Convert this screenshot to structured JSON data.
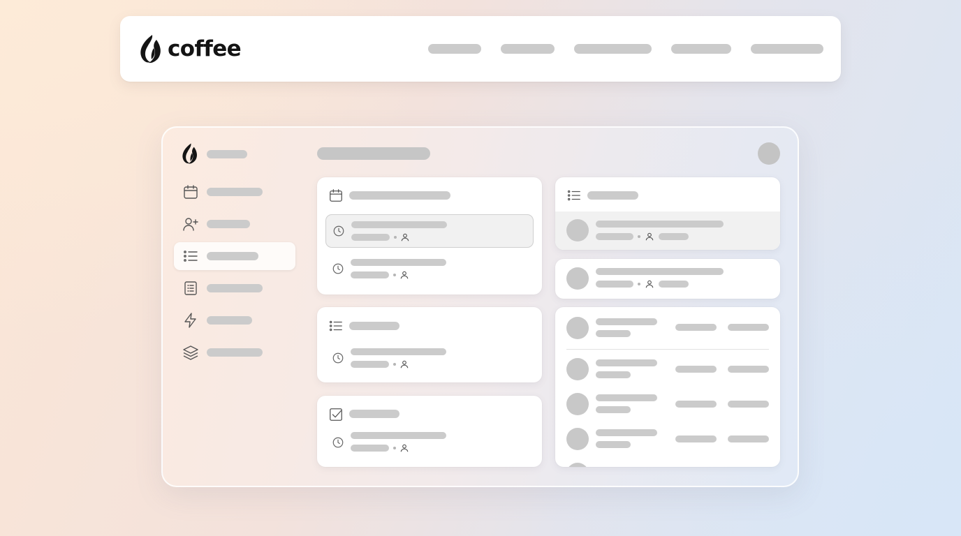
{
  "brand": {
    "name": "coffee",
    "logo_icon": "coffee-bean-flame-logo"
  },
  "colors": {
    "placeholder": "#cbcbcb",
    "card": "#ffffff",
    "text": "#141414",
    "background_warm": "#fbe6d6",
    "background_cool": "#d9e6f5"
  },
  "sidebar": {
    "items": [
      {
        "icon": "calendar-icon"
      },
      {
        "icon": "add-user-icon"
      },
      {
        "icon": "list-icon",
        "active": true
      },
      {
        "icon": "document-list-icon"
      },
      {
        "icon": "lightning-icon"
      },
      {
        "icon": "layers-icon"
      }
    ]
  }
}
